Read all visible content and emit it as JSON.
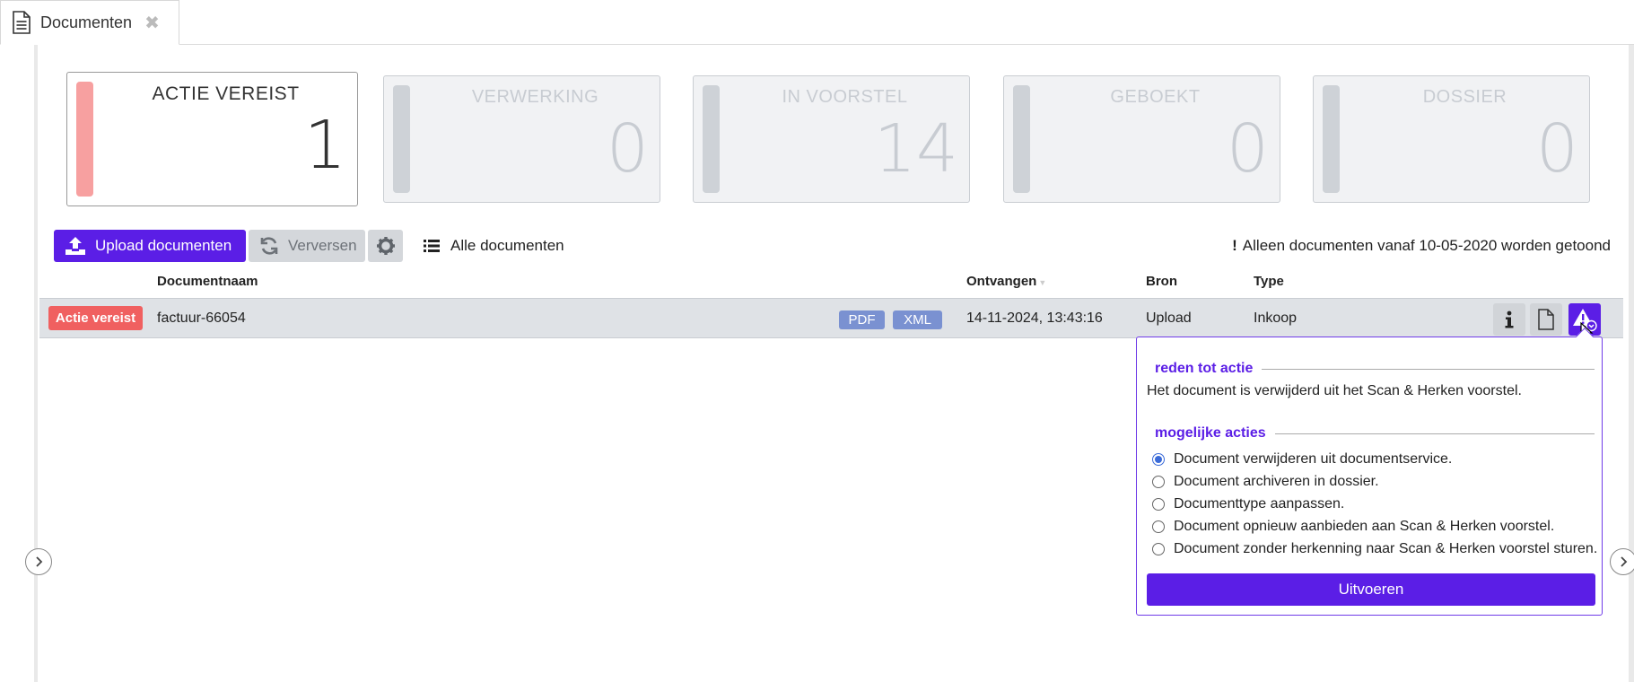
{
  "tab": {
    "title": "Documenten",
    "icon": "document-icon",
    "close_icon": "close-icon"
  },
  "cards": [
    {
      "title": "ACTIE VEREIST",
      "count": "1",
      "accent": "#f7a0a0",
      "active": true
    },
    {
      "title": "VERWERKING",
      "count": "0",
      "accent": "#ced2d7",
      "active": false
    },
    {
      "title": "IN VOORSTEL",
      "count": "14",
      "accent": "#ced2d7",
      "active": false
    },
    {
      "title": "GEBOEKT",
      "count": "0",
      "accent": "#ced2d7",
      "active": false
    },
    {
      "title": "DOSSIER",
      "count": "0",
      "accent": "#ced2d7",
      "active": false
    }
  ],
  "toolbar": {
    "upload_label": "Upload documenten",
    "refresh_label": "Verversen",
    "view_label": "Alle documenten",
    "notice": "Alleen documenten vanaf 10-05-2020 worden getoond"
  },
  "table": {
    "headers": {
      "name": "Documentnaam",
      "received": "Ontvangen",
      "source": "Bron",
      "type": "Type"
    },
    "rows": [
      {
        "status": "Actie vereist",
        "name": "factuur-66054",
        "formats": [
          "PDF",
          "XML"
        ],
        "received": "14-11-2024, 13:43:16",
        "source": "Upload",
        "type": "Inkoop"
      }
    ]
  },
  "popover": {
    "reason_heading": "reden tot actie",
    "reason_text": "Het document is verwijderd uit het Scan & Herken voorstel.",
    "actions_heading": "mogelijke acties",
    "options": [
      "Document verwijderen uit documentservice.",
      "Document archiveren in dossier.",
      "Documenttype aanpassen.",
      "Document opnieuw aanbieden aan Scan & Herken voorstel.",
      "Document zonder herkenning naar Scan & Herken voorstel sturen."
    ],
    "selected_option": 0,
    "execute_label": "Uitvoeren"
  },
  "colors": {
    "primary": "#5b1ee6",
    "danger": "#f06060",
    "format_badge": "#7a91d1"
  }
}
